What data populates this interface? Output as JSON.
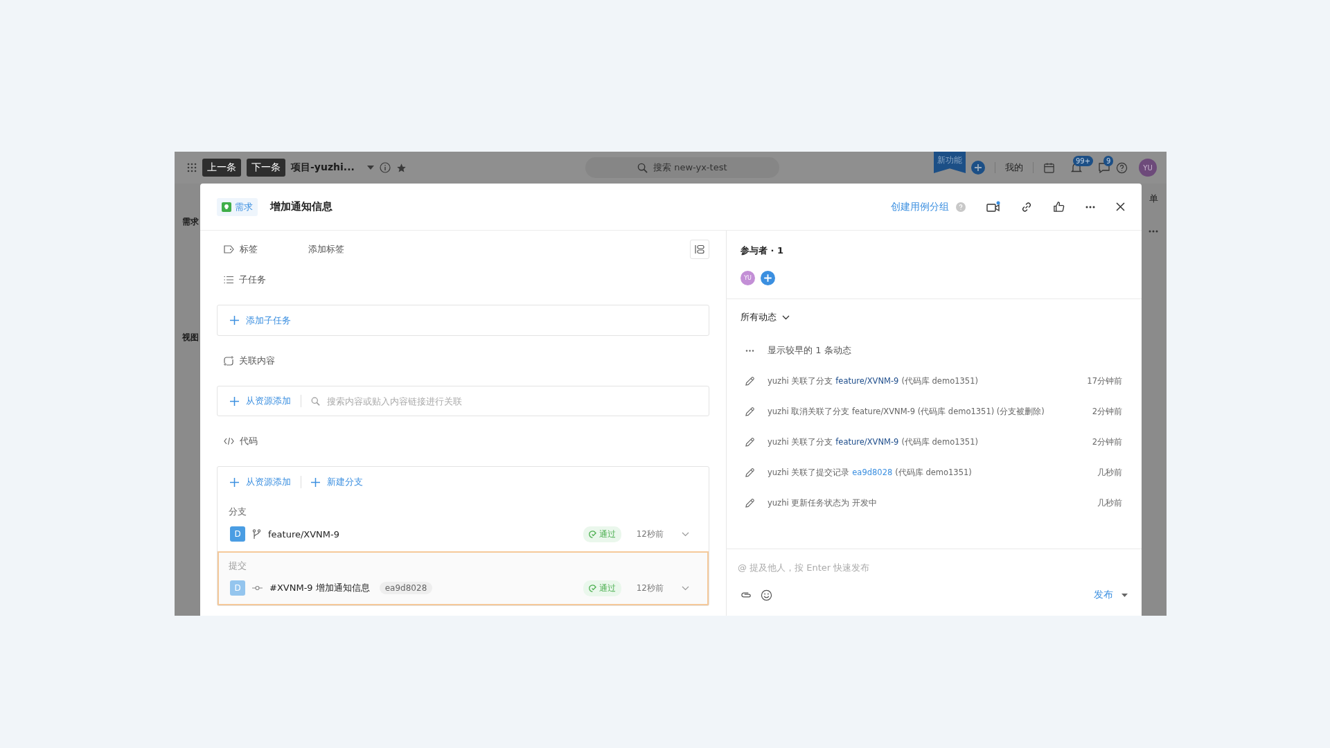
{
  "topbar": {
    "prev": "上一条",
    "next": "下一条",
    "project": "项目-yuzhi...",
    "search_placeholder": "搜索 new-yx-test",
    "new_feature": "新功能",
    "mine": "我的",
    "bell_badge": "99+",
    "message_badge": "9",
    "avatar": "YU"
  },
  "backdrop": {
    "sidebar_items": [
      "需求",
      "视图"
    ],
    "right_text": "单"
  },
  "modal": {
    "type_tag": "需求",
    "title": "增加通知信息",
    "create_group": "创建用例分组",
    "left": {
      "tags_label": "标签",
      "add_tags": "添加标签",
      "subtasks_label": "子任务",
      "add_subtask": "添加子任务",
      "related_label": "关联内容",
      "add_from_resource": "从资源添加",
      "related_search_placeholder": "搜索内容或贴入内容链接进行关联",
      "code_label": "代码",
      "code_actions": [
        "从资源添加",
        "新建分支"
      ],
      "branches": {
        "label": "分支",
        "highlighted": false,
        "items": [
          {
            "avatar": "D",
            "name": "feature/XVNM-9",
            "status": "通过",
            "time": "12秒前"
          }
        ]
      },
      "commits": {
        "label": "提交",
        "highlighted": true,
        "items": [
          {
            "avatar": "D",
            "name": "#XVNM-9 增加通知信息",
            "hash": "ea9d8028",
            "status": "通过",
            "time": "12秒前"
          }
        ]
      }
    },
    "right": {
      "participants_title": "参与者 · 1",
      "participants": [
        {
          "initials": "YU"
        }
      ],
      "activity_filter": "所有动态",
      "show_earlier": "显示较早的 1 条动态",
      "activities": [
        {
          "kind": "branch",
          "text": "yuzhi 关联了分支",
          "link": "feature/XVNM-9",
          "suffix": "(代码库 demo1351)",
          "time": "17分钟前"
        },
        {
          "kind": "plain",
          "text": "yuzhi 取消关联了分支 feature/XVNM-9 (代码库 demo1351) (分支被删除)",
          "time": "2分钟前"
        },
        {
          "kind": "branch",
          "text": "yuzhi 关联了分支",
          "link": "feature/XVNM-9",
          "suffix": "(代码库 demo1351)",
          "time": "2分钟前"
        },
        {
          "kind": "commit",
          "text": "yuzhi 关联了提交记录",
          "link": "ea9d8028",
          "suffix": "(代码库 demo1351)",
          "time": "几秒前"
        },
        {
          "kind": "plain",
          "text": "yuzhi 更新任务状态为 开发中",
          "time": "几秒前"
        }
      ],
      "comment_placeholder": "@ 提及他人，按 Enter 快速发布",
      "publish": "发布"
    }
  }
}
